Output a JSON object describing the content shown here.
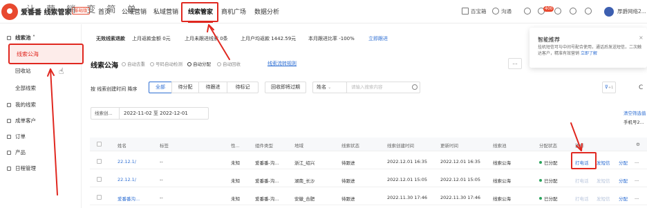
{
  "overlay_text": "让 营 销 变 简 单",
  "brand": {
    "name": "爱番番 线索管家",
    "badge": "基础版"
  },
  "nav": {
    "tabs": [
      "首页",
      "公域营销",
      "私域营销",
      "线索管家",
      "商机广场",
      "数据分析"
    ],
    "active": "线索管家"
  },
  "header_right": {
    "baike": "百宝箱",
    "chat": "沟通",
    "badge_count": "400",
    "user": "厚爵网络2..."
  },
  "sidebar": {
    "group": "线索池",
    "items": [
      "线索公海",
      "回收站",
      "全部线索"
    ],
    "sections": [
      "我的线索",
      "成单客户",
      "订单",
      "产品",
      "日程管理"
    ]
  },
  "notice": {
    "items": [
      "无效线索退款",
      "上月返款金额 0元",
      "上月未跟进线索 0条",
      "上月户均返款 1442.59元",
      "本月跟进比率 -100%"
    ],
    "link": "立即跟进"
  },
  "page": {
    "title": "线索公海",
    "options": [
      "自动去重",
      "号码自动检测",
      "自动分配",
      "自动回收"
    ],
    "rule_link": "线索流转规则",
    "more": "..."
  },
  "toolbar": {
    "sort_label": "按 线索创建时间 降序",
    "pills": [
      "全部",
      "待分配",
      "待跟进",
      "待标记"
    ],
    "expire_pill": "回收即将过期",
    "field": "姓名",
    "search_placeholder": "请输入搜索内容",
    "filter_count": "+1",
    "refresh": "C"
  },
  "date": {
    "label": "线索创...",
    "range": "2022-11-02  至  2022-12-01"
  },
  "right_links": {
    "clear": "清空筛选值",
    "phone": "手机号2..."
  },
  "table": {
    "headers": [
      "姓名",
      "标签",
      "性...",
      "组件类型",
      "地域",
      "线索状态",
      "线索创建时间",
      "更新时间",
      "线索池",
      "分配状态",
      "操作"
    ],
    "rows": [
      {
        "name": "22.12.1/",
        "tag": "--",
        "gender": "未知",
        "comp": "爱番番-沟...",
        "region": "浙江_绍兴",
        "status": "待跟进",
        "created": "2022.12.01 16:35",
        "updated": "2022.12.01 16:35",
        "pool": "线索公海",
        "assign": "已分配",
        "ops": [
          "打电话",
          "发短信",
          "分配",
          "..."
        ]
      },
      {
        "name": "22.12.1/",
        "tag": "--",
        "gender": "未知",
        "comp": "爱番番-沟...",
        "region": "湖南_长沙",
        "status": "待跟进",
        "created": "2022.12.01 15:05",
        "updated": "2022.12.01 15:05",
        "pool": "线索公海",
        "assign": "已分配",
        "ops": [
          "打电话",
          "发短信",
          "分配",
          "..."
        ]
      },
      {
        "name": "爱番番沟...",
        "tag": "--",
        "gender": "未知",
        "comp": "爱番番-沟...",
        "region": "安徽_合肥",
        "status": "待跟进",
        "created": "2022.11.30 17:46",
        "updated": "2022.11.30 17:46",
        "pool": "线索公海",
        "assign": "已分配",
        "ops": [
          "打电话",
          "发短信",
          "分配",
          "..."
        ]
      }
    ]
  },
  "popup": {
    "title": "智能推荐",
    "body": "挂机短信可与中间号配合使用，通话后发送短信，二次触达客户，精准有效营销",
    "link": "立即了解",
    "close": "×"
  },
  "colors": {
    "accent": "#e0271f",
    "link": "#2d6ed3",
    "success": "#2aa45c"
  }
}
